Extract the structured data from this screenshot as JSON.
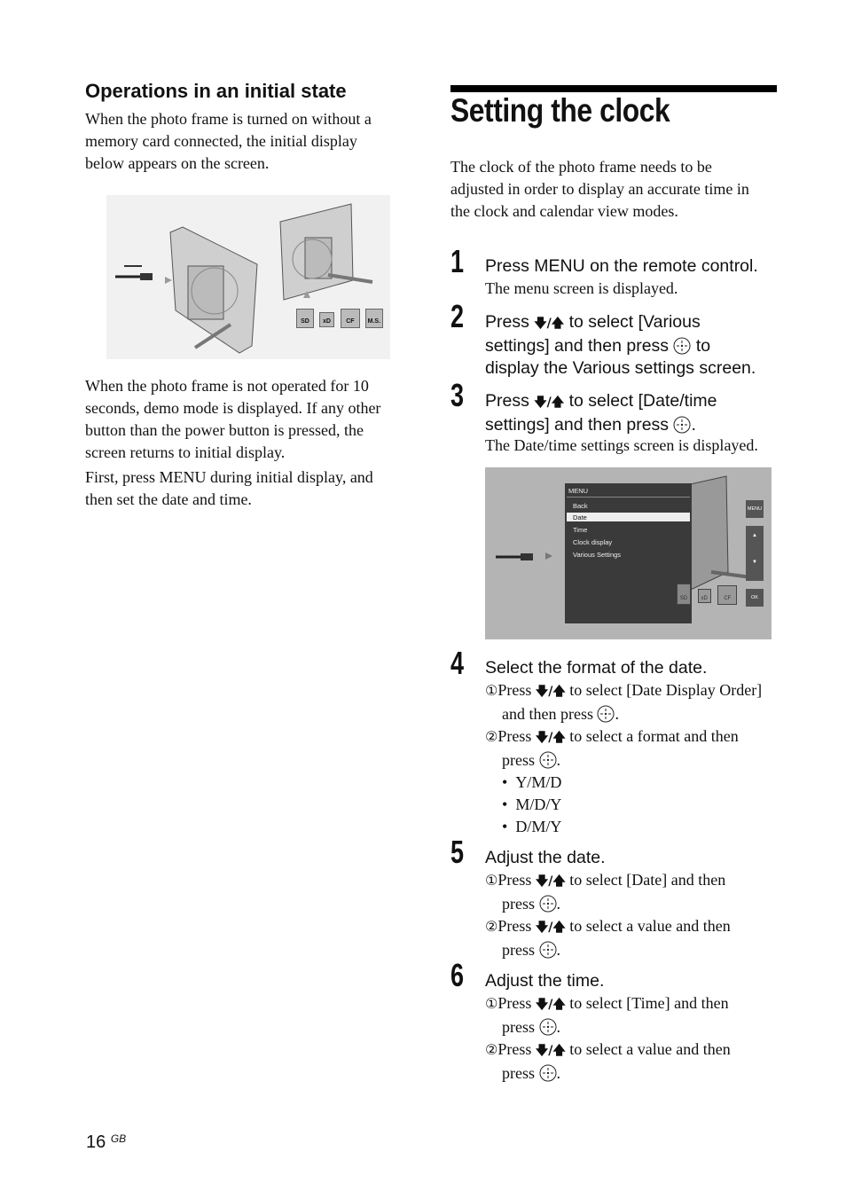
{
  "left": {
    "heading": "Operations in an initial state",
    "para1": [
      "When the photo frame is turned on without a",
      "memory card connected, the initial display",
      "below appears on the screen."
    ],
    "figure_labels": [
      "SD",
      "xD",
      "CF",
      "M.S."
    ],
    "para2": [
      "When the photo frame is not operated for 10",
      "seconds, demo mode is displayed. If any other",
      "button than the power button is pressed, the",
      "screen returns to initial display."
    ],
    "para3": [
      "First, press MENU during initial display, and",
      "then set the date and time."
    ]
  },
  "right": {
    "title": "Setting the clock",
    "intro": [
      "The clock of the photo frame needs to be",
      "adjusted in order to display an accurate time in",
      "the clock and calendar view modes."
    ],
    "arrows": "🡇/🡅",
    "step1": {
      "num": "1",
      "text": "Press MENU on the remote control.",
      "note": "The menu screen is displayed."
    },
    "step2": {
      "num": "2",
      "l1a": "Press ",
      "l1b": " to select [Various",
      "l2a": "settings] and then press ",
      "l2b": " to",
      "l3": "display the Various settings screen."
    },
    "step3": {
      "num": "3",
      "l1a": "Press ",
      "l1b": " to select [Date/time",
      "l2a": "settings] and then press ",
      "l2b": ".",
      "note": "The Date/time settings screen is displayed."
    },
    "screen": {
      "menu_title": "MENU",
      "items": [
        "Back",
        "Date",
        "Time",
        "Clock display",
        "Various Settings"
      ],
      "selected": "Date",
      "buttons": [
        "MENU",
        "OK"
      ],
      "cards": [
        "SD",
        "xD",
        "CF"
      ]
    },
    "step4": {
      "num": "4",
      "text": "Select the format of the date.",
      "s1": {
        "mark": "①",
        "a": "Press ",
        "b": " to select [Date Display Order]",
        "c": "and then press ",
        "d": "."
      },
      "s2": {
        "mark": "②",
        "a": "Press ",
        "b": " to select a format and then",
        "c": "press ",
        "d": "."
      },
      "bullets": [
        "Y/M/D",
        "M/D/Y",
        "D/M/Y"
      ]
    },
    "step5": {
      "num": "5",
      "text": "Adjust the date.",
      "s1": {
        "mark": "①",
        "a": "Press ",
        "b": " to select [Date] and then",
        "c": "press ",
        "d": "."
      },
      "s2": {
        "mark": "②",
        "a": "Press ",
        "b": " to select a value and then",
        "c": "press ",
        "d": "."
      }
    },
    "step6": {
      "num": "6",
      "text": "Adjust the time.",
      "s1": {
        "mark": "①",
        "a": "Press ",
        "b": " to select [Time] and then",
        "c": "press ",
        "d": "."
      },
      "s2": {
        "mark": "②",
        "a": "Press ",
        "b": " to select a value and then",
        "c": "press ",
        "d": "."
      }
    }
  },
  "footer": {
    "page": "16",
    "lang": "GB"
  }
}
